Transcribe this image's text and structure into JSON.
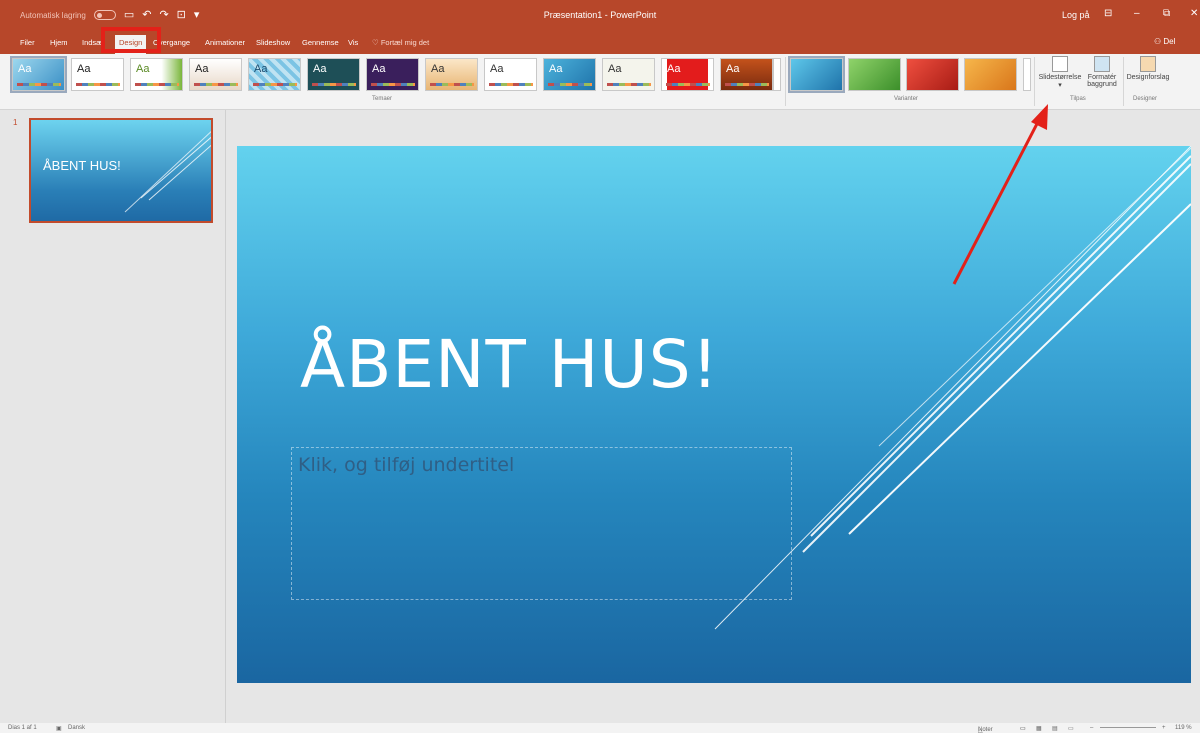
{
  "titlebar": {
    "autosave_label": "Automatisk lagring",
    "title": "Præsentation1 - PowerPoint",
    "login": "Log på"
  },
  "tabs": [
    {
      "label": "Filer"
    },
    {
      "label": "Hjem"
    },
    {
      "label": "Indsæt"
    },
    {
      "label": "Design",
      "active": true
    },
    {
      "label": "Overgange"
    },
    {
      "label": "Animationer"
    },
    {
      "label": "Slideshow"
    },
    {
      "label": "Gennemse"
    },
    {
      "label": "Vis"
    }
  ],
  "tell_me": "Fortæl mig det",
  "share_label": "Del",
  "ribbon": {
    "theme_sample": "Aa",
    "group_themes": "Temaer",
    "group_variants": "Varianter",
    "group_customize": "Tilpas",
    "group_designer": "Designer",
    "slide_size": "Slidestørrelse",
    "format_bg_1": "Formatér",
    "format_bg_2": "baggrund",
    "design_ideas": "Designforslag"
  },
  "pane": {
    "slide_number": "1",
    "thumb_title": "ÅBENT HUS!"
  },
  "slide": {
    "title": "ÅBENT HUS!",
    "subtitle_placeholder": "Klik, og tilføj undertitel"
  },
  "status": {
    "slide_info": "Dias 1 af 1",
    "language": "Dansk",
    "notes": "Noter",
    "zoom": "119 %"
  },
  "colors": {
    "accent": "#b7472a",
    "callout": "#e32119",
    "slide_top": "#63d2ee",
    "slide_bottom": "#1a66a1"
  }
}
